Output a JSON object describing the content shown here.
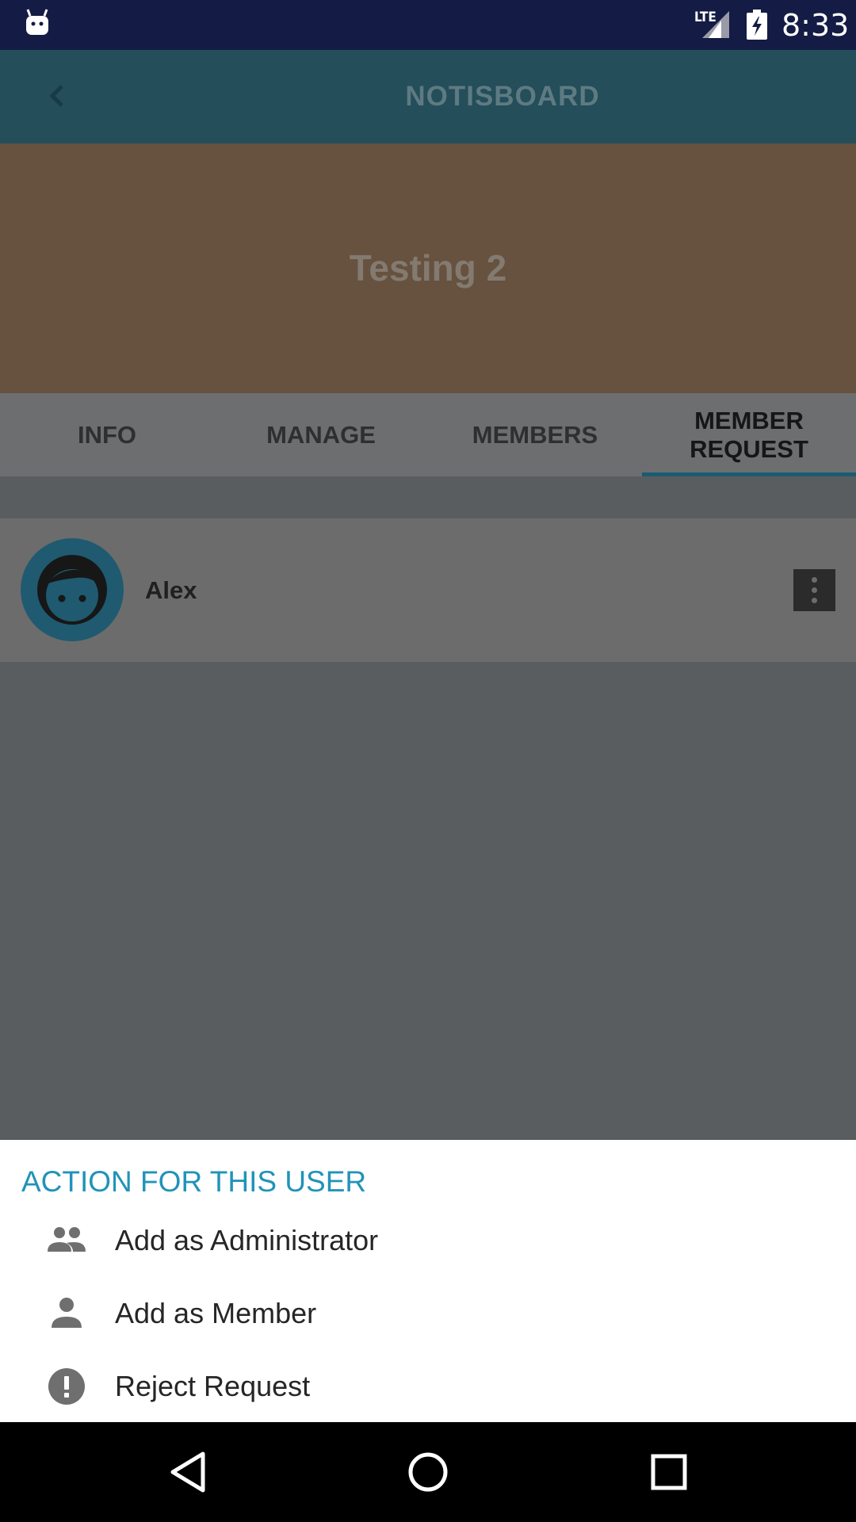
{
  "status_bar": {
    "network": "LTE",
    "time": "8:33",
    "icons": [
      "android-icon",
      "signal-icon",
      "battery-charging-icon"
    ]
  },
  "app_bar": {
    "title": "NOTISBOARD",
    "back_icon": "chevron-left-icon"
  },
  "banner": {
    "board_name": "Testing 2"
  },
  "tabs": [
    {
      "label": "INFO",
      "active": false
    },
    {
      "label": "MANAGE",
      "active": false
    },
    {
      "label": "MEMBERS",
      "active": false
    },
    {
      "label": "MEMBER\nREQUEST",
      "active": true
    }
  ],
  "requests": [
    {
      "name": "Alex",
      "avatar_icon": "face-icon",
      "menu_icon": "more-vert-icon"
    }
  ],
  "sheet": {
    "title": "ACTION FOR THIS USER",
    "actions": [
      {
        "label": "Add as Administrator",
        "icon": "people-icon"
      },
      {
        "label": "Add as Member",
        "icon": "person-icon"
      },
      {
        "label": "Reject Request",
        "icon": "alert-circle-icon"
      }
    ]
  },
  "nav_bar": {
    "buttons": [
      "back-triangle-icon",
      "home-circle-icon",
      "recents-square-icon"
    ]
  },
  "colors": {
    "status_bar": "#141b44",
    "accent": "#2193b8",
    "sheet_background": "#ffffff"
  }
}
